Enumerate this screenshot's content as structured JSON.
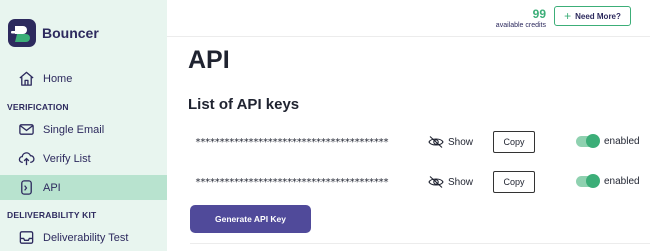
{
  "brand": {
    "name": "Bouncer",
    "accent": "#3cae78",
    "primary": "#504a9a",
    "sidebar_bg": "#e8f5ef",
    "active_bg": "#b8e3cf"
  },
  "sidebar": {
    "home": {
      "label": "Home",
      "icon": "home-icon"
    },
    "sections": [
      {
        "label": "VERIFICATION"
      },
      {
        "label": "DELIVERABILITY KIT"
      }
    ],
    "items": [
      {
        "label": "Single Email",
        "icon": "mail-icon"
      },
      {
        "label": "Verify List",
        "icon": "upload-cloud-icon"
      },
      {
        "label": "API",
        "icon": "api-icon",
        "active": true
      },
      {
        "label": "Deliverability Test",
        "icon": "inbox-icon"
      }
    ]
  },
  "topbar": {
    "credits": "99",
    "credits_label": "available credits",
    "need_more": "Need More?"
  },
  "main": {
    "title": "API",
    "section_title": "List of API keys",
    "keys": [
      {
        "masked": "****************************************",
        "show_label": "Show",
        "copy_label": "Copy",
        "status": "enabled"
      },
      {
        "masked": "****************************************",
        "show_label": "Show",
        "copy_label": "Copy",
        "status": "enabled"
      }
    ],
    "generate_label": "Generate API Key"
  }
}
